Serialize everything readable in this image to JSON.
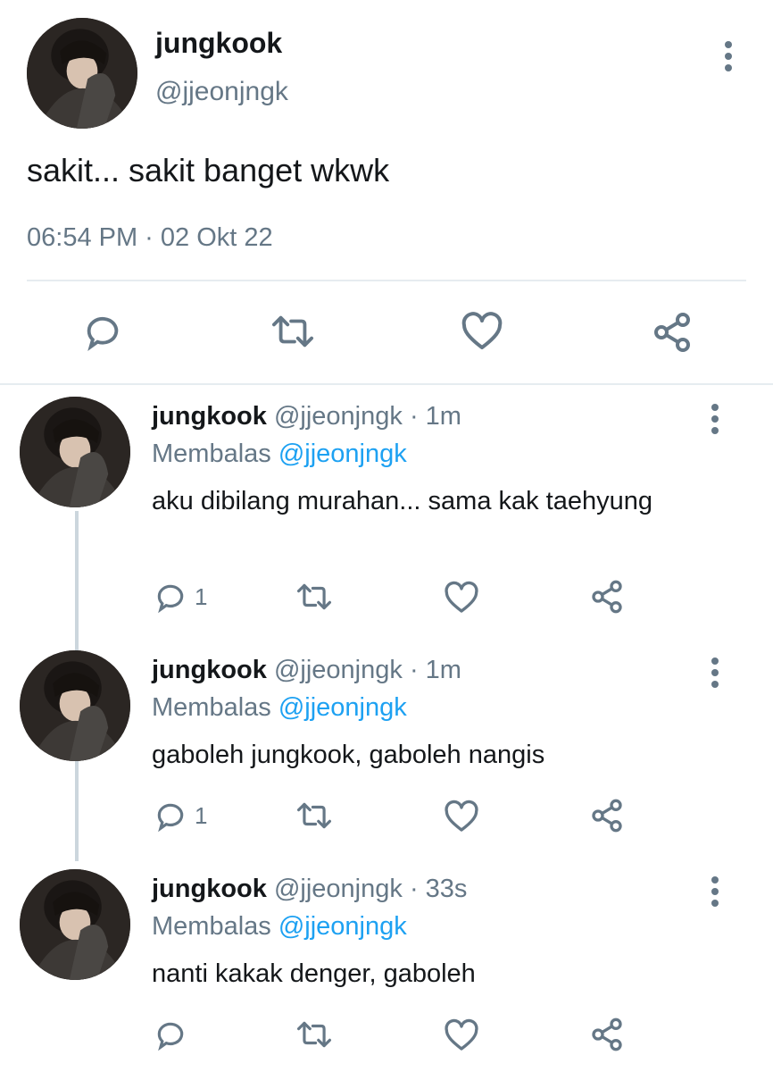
{
  "main_tweet": {
    "name": "jungkook",
    "handle": "@jjeonjngk",
    "text": "sakit... sakit banget wkwk",
    "timestamp": "06:54 PM · 02 Okt 22",
    "actions": [
      "reply-icon",
      "retweet-icon",
      "like-icon",
      "share-icon"
    ]
  },
  "replies": [
    {
      "name": "jungkook",
      "handle": "@jjeonjngk",
      "separator": "·",
      "time": "1m",
      "replying_label": "Membalas",
      "replying_to": "@jjeonjngk",
      "text": "aku dibilang murahan... sama kak taehyung",
      "reply_count": "1"
    },
    {
      "name": "jungkook",
      "handle": "@jjeonjngk",
      "separator": "·",
      "time": "1m",
      "replying_label": "Membalas",
      "replying_to": "@jjeonjngk",
      "text": "gaboleh jungkook, gaboleh nangis",
      "reply_count": "1"
    },
    {
      "name": "jungkook",
      "handle": "@jjeonjngk",
      "separator": "·",
      "time": "33s",
      "replying_label": "Membalas",
      "replying_to": "@jjeonjngk",
      "text": "nanti kakak denger, gaboleh",
      "reply_count": ""
    }
  ],
  "colors": {
    "text": "#14171a",
    "secondary": "#657786",
    "accent": "#1da1f2",
    "divider": "#e6ecf0"
  }
}
